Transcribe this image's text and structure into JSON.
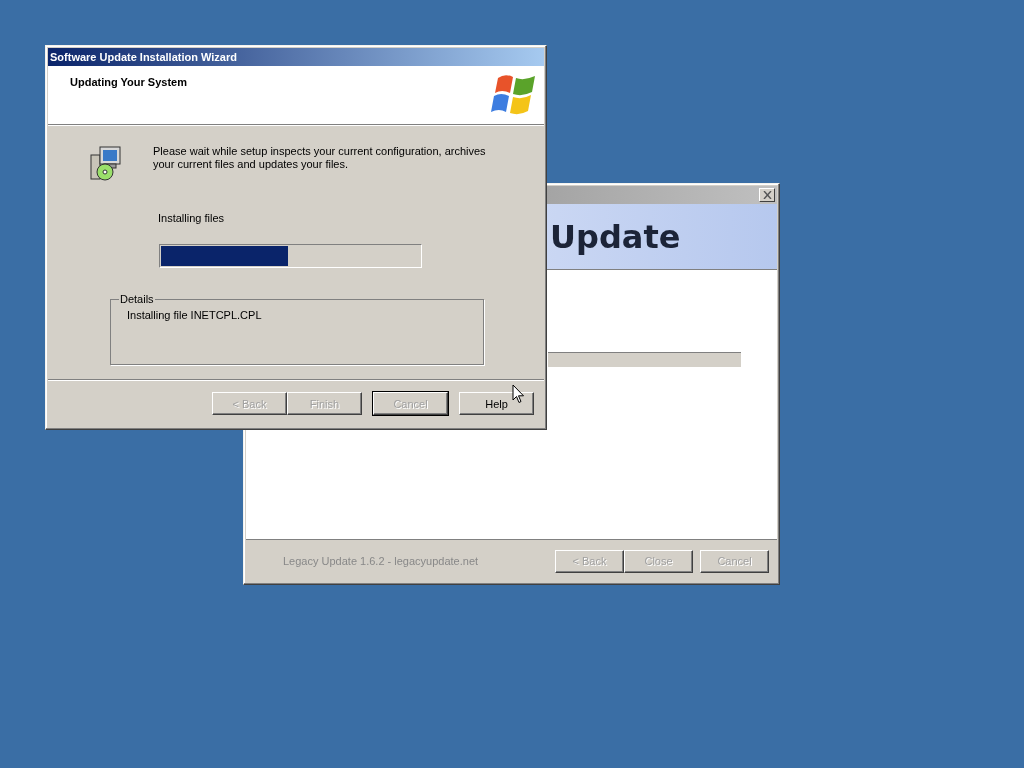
{
  "back_window": {
    "header_title": "Update",
    "footer_text": "Legacy Update 1.6.2 - legacyupdate.net",
    "buttons": [
      {
        "label": "< Back",
        "disabled": true
      },
      {
        "label": "Close",
        "disabled": true
      },
      {
        "label": "Cancel",
        "disabled": true
      }
    ]
  },
  "wizard": {
    "title": "Software Update Installation Wizard",
    "heading": "Updating Your System",
    "message": "Please wait while setup inspects your current configuration, archives your current files and updates your files.",
    "status": "Installing files",
    "progress": {
      "level": 0.49
    },
    "details": {
      "legend": "Details",
      "text": "Installing file INETCPL.CPL"
    },
    "buttons": [
      {
        "label": "< Back",
        "disabled": true,
        "default": false
      },
      {
        "label": "Finish",
        "disabled": true,
        "default": false
      },
      {
        "label": "Cancel",
        "disabled": true,
        "default": true
      },
      {
        "label": "Help",
        "disabled": false,
        "default": false
      }
    ]
  }
}
